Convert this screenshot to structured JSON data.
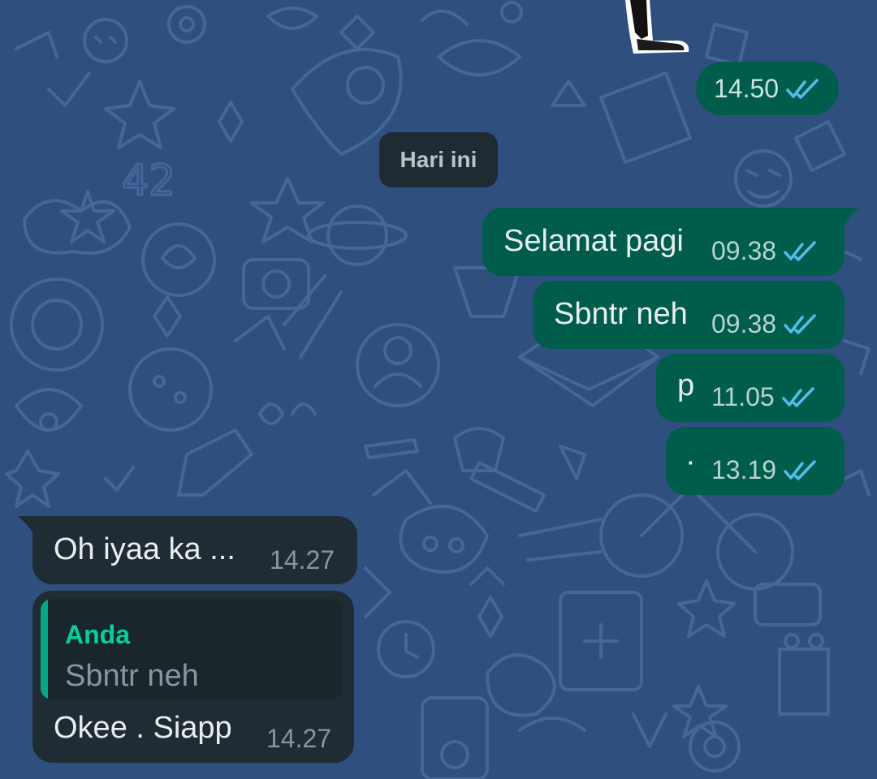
{
  "date_separator": "Hari ini",
  "sticker_message": {
    "time": "14.50",
    "status": "read"
  },
  "messages": [
    {
      "direction": "out",
      "text": "Selamat pagi",
      "time": "09.38",
      "status": "read"
    },
    {
      "direction": "out",
      "text": "Sbntr neh",
      "time": "09.38",
      "status": "read"
    },
    {
      "direction": "out",
      "text": "p",
      "time": "11.05",
      "status": "read"
    },
    {
      "direction": "out",
      "text": "·",
      "time": "13.19",
      "status": "read"
    },
    {
      "direction": "in",
      "text": "Oh iyaa ka ...",
      "time": "14.27"
    },
    {
      "direction": "in",
      "text": "Okee . Siapp",
      "time": "14.27",
      "reply_to": {
        "author": "Anda",
        "text": "Sbntr neh"
      }
    }
  ],
  "colors": {
    "wallpaper": "#2f4f7f",
    "outgoing_bubble": "#005c4b",
    "incoming_bubble": "#1f2c34",
    "read_tick": "#53bdeb",
    "quote_accent": "#06cf9c"
  },
  "icons": {
    "read_status": "double-check-icon"
  }
}
